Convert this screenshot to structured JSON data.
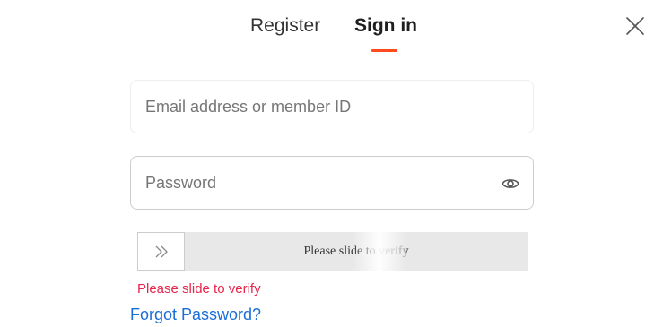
{
  "tabs": {
    "register_label": "Register",
    "signin_label": "Sign in",
    "active": "Sign in"
  },
  "form": {
    "email_placeholder": "Email address or member ID",
    "email_value": "",
    "password_placeholder": "Password",
    "password_value": ""
  },
  "slider": {
    "text": "Please slide to verify",
    "progress": 0
  },
  "error": {
    "message": "Please slide to verify"
  },
  "links": {
    "forgot_password": "Forgot Password?"
  },
  "icons": {
    "close": "close-icon",
    "eye": "eye-icon",
    "slider_arrow": "double-chevron-right-icon"
  },
  "colors": {
    "accent_underline": "#ff4b1f",
    "error": "#e8254a",
    "link": "#1a6ed8"
  }
}
